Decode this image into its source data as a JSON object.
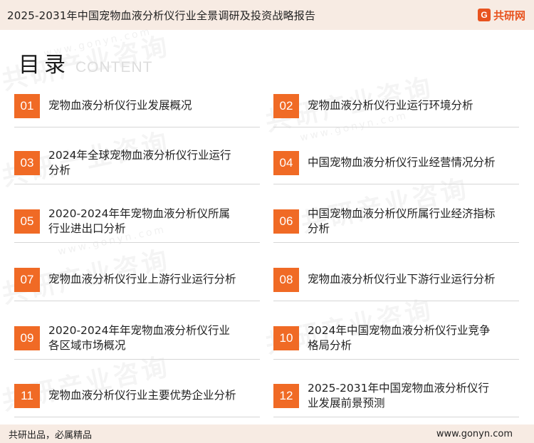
{
  "header": {
    "title": "2025-2031年中国宠物血液分析仪行业全景调研及投资战略报告",
    "brand_icon": "G",
    "brand_name": "共研网"
  },
  "watermark": {
    "cn": "共研产业咨询",
    "domain": "www.gonyn.com"
  },
  "section": {
    "title": "目录",
    "subtitle": "CONTENT"
  },
  "colors": {
    "accent": "#f06a25",
    "header_bg": "#f7ebe3"
  },
  "toc": [
    {
      "num": "01",
      "text": "宠物血液分析仪行业发展概况"
    },
    {
      "num": "02",
      "text": "宠物血液分析仪行业运行环境分析"
    },
    {
      "num": "03",
      "text": "2024年全球宠物血液分析仪行业运行分析"
    },
    {
      "num": "04",
      "text": "中国宠物血液分析仪行业经营情况分析"
    },
    {
      "num": "05",
      "text": "2020-2024年年宠物血液分析仪所属行业进出口分析"
    },
    {
      "num": "06",
      "text": "中国宠物血液分析仪所属行业经济指标分析"
    },
    {
      "num": "07",
      "text": "宠物血液分析仪行业上游行业运行分析"
    },
    {
      "num": "08",
      "text": "宠物血液分析仪行业下游行业运行分析"
    },
    {
      "num": "09",
      "text": "2020-2024年年宠物血液分析仪行业各区域市场概况"
    },
    {
      "num": "10",
      "text": "2024年中国宠物血液分析仪行业竞争格局分析"
    },
    {
      "num": "11",
      "text": "宠物血液分析仪行业主要优势企业分析"
    },
    {
      "num": "12",
      "text": "2025-2031年中国宠物血液分析仪行业发展前景预测"
    }
  ],
  "footer": {
    "left": "共研出品，必属精品",
    "right": "www.gonyn.com"
  }
}
